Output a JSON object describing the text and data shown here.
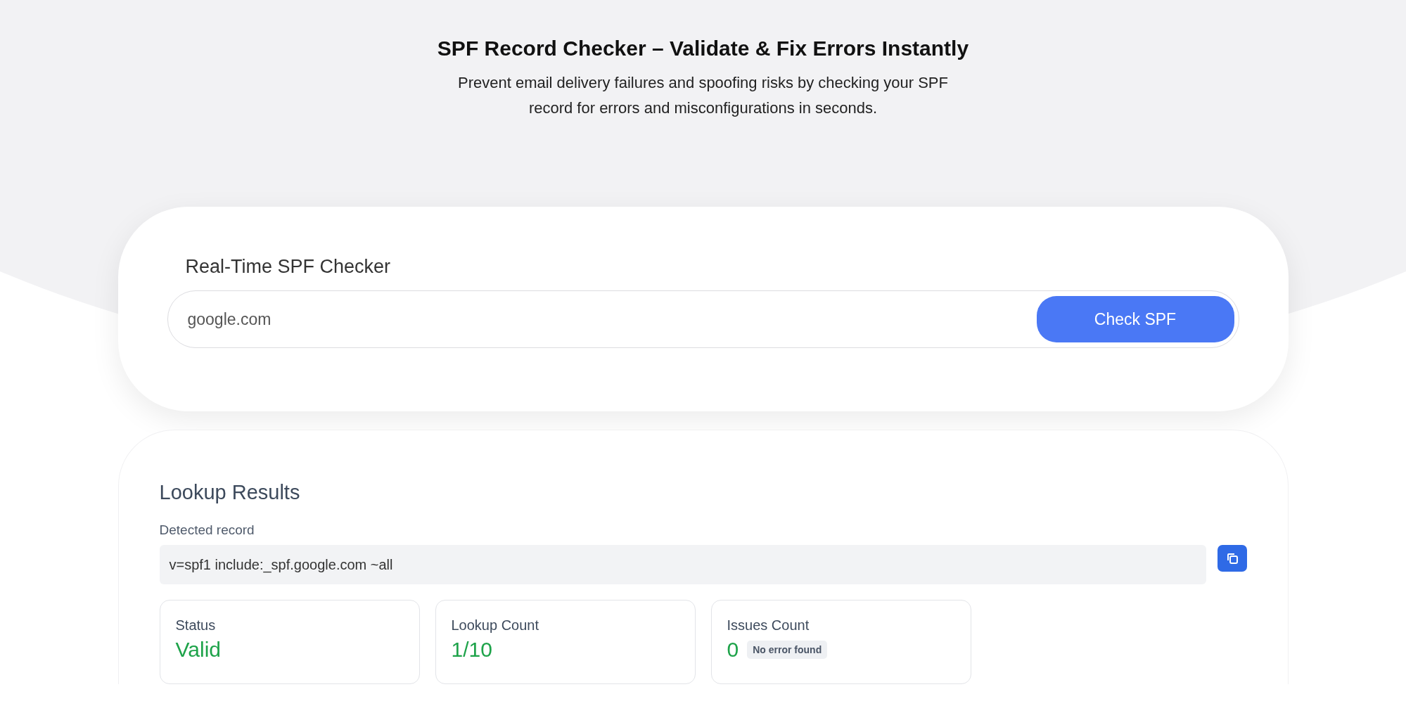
{
  "header": {
    "title": "SPF Record Checker – Validate & Fix Errors Instantly",
    "subtitle": "Prevent email delivery failures and spoofing risks by checking your SPF record for errors and misconfigurations in seconds."
  },
  "checker": {
    "title": "Real-Time SPF Checker",
    "domain": "google.com",
    "button": "Check SPF"
  },
  "results": {
    "title": "Lookup Results",
    "record_label": "Detected record",
    "record": "v=spf1 include:_spf.google.com ~all",
    "stats": [
      {
        "label": "Status",
        "value": "Valid"
      },
      {
        "label": "Lookup Count",
        "value": "1/10"
      },
      {
        "label": "Issues Count",
        "value": "0",
        "badge": "No error found"
      }
    ]
  }
}
